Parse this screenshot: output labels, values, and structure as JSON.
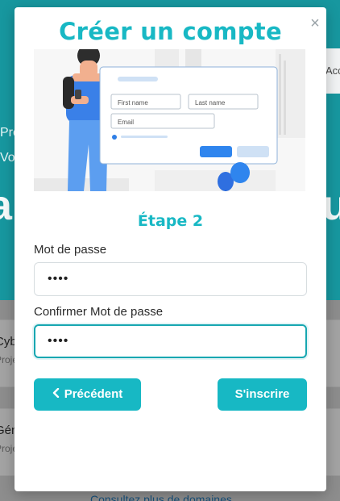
{
  "background": {
    "hero_button_label": "Accéder",
    "hero_line_1": "Projets",
    "hero_line_2": "Vous",
    "hero_big_left": "a",
    "hero_big_right": "u",
    "cards": [
      {
        "title": "Cybersécurité",
        "subtitle": "Projet"
      },
      {
        "title": "Génie",
        "subtitle": "Projet"
      }
    ],
    "more_link": "Consultez plus de domaines"
  },
  "modal": {
    "title": "Créer un compte",
    "close_label": "×",
    "illustration": {
      "first_name_placeholder": "First name",
      "last_name_placeholder": "Last name",
      "email_placeholder": "Email"
    },
    "step_title": "Étape 2",
    "password_label": "Mot de passe",
    "password_value": "••••",
    "confirm_label": "Confirmer Mot de passe",
    "confirm_value": "••••",
    "prev_button": "Précédent",
    "submit_button": "S'inscrire"
  },
  "colors": {
    "accent": "#18b8c4",
    "hero_bg": "#17979f",
    "focus_border": "#17a7b1"
  }
}
